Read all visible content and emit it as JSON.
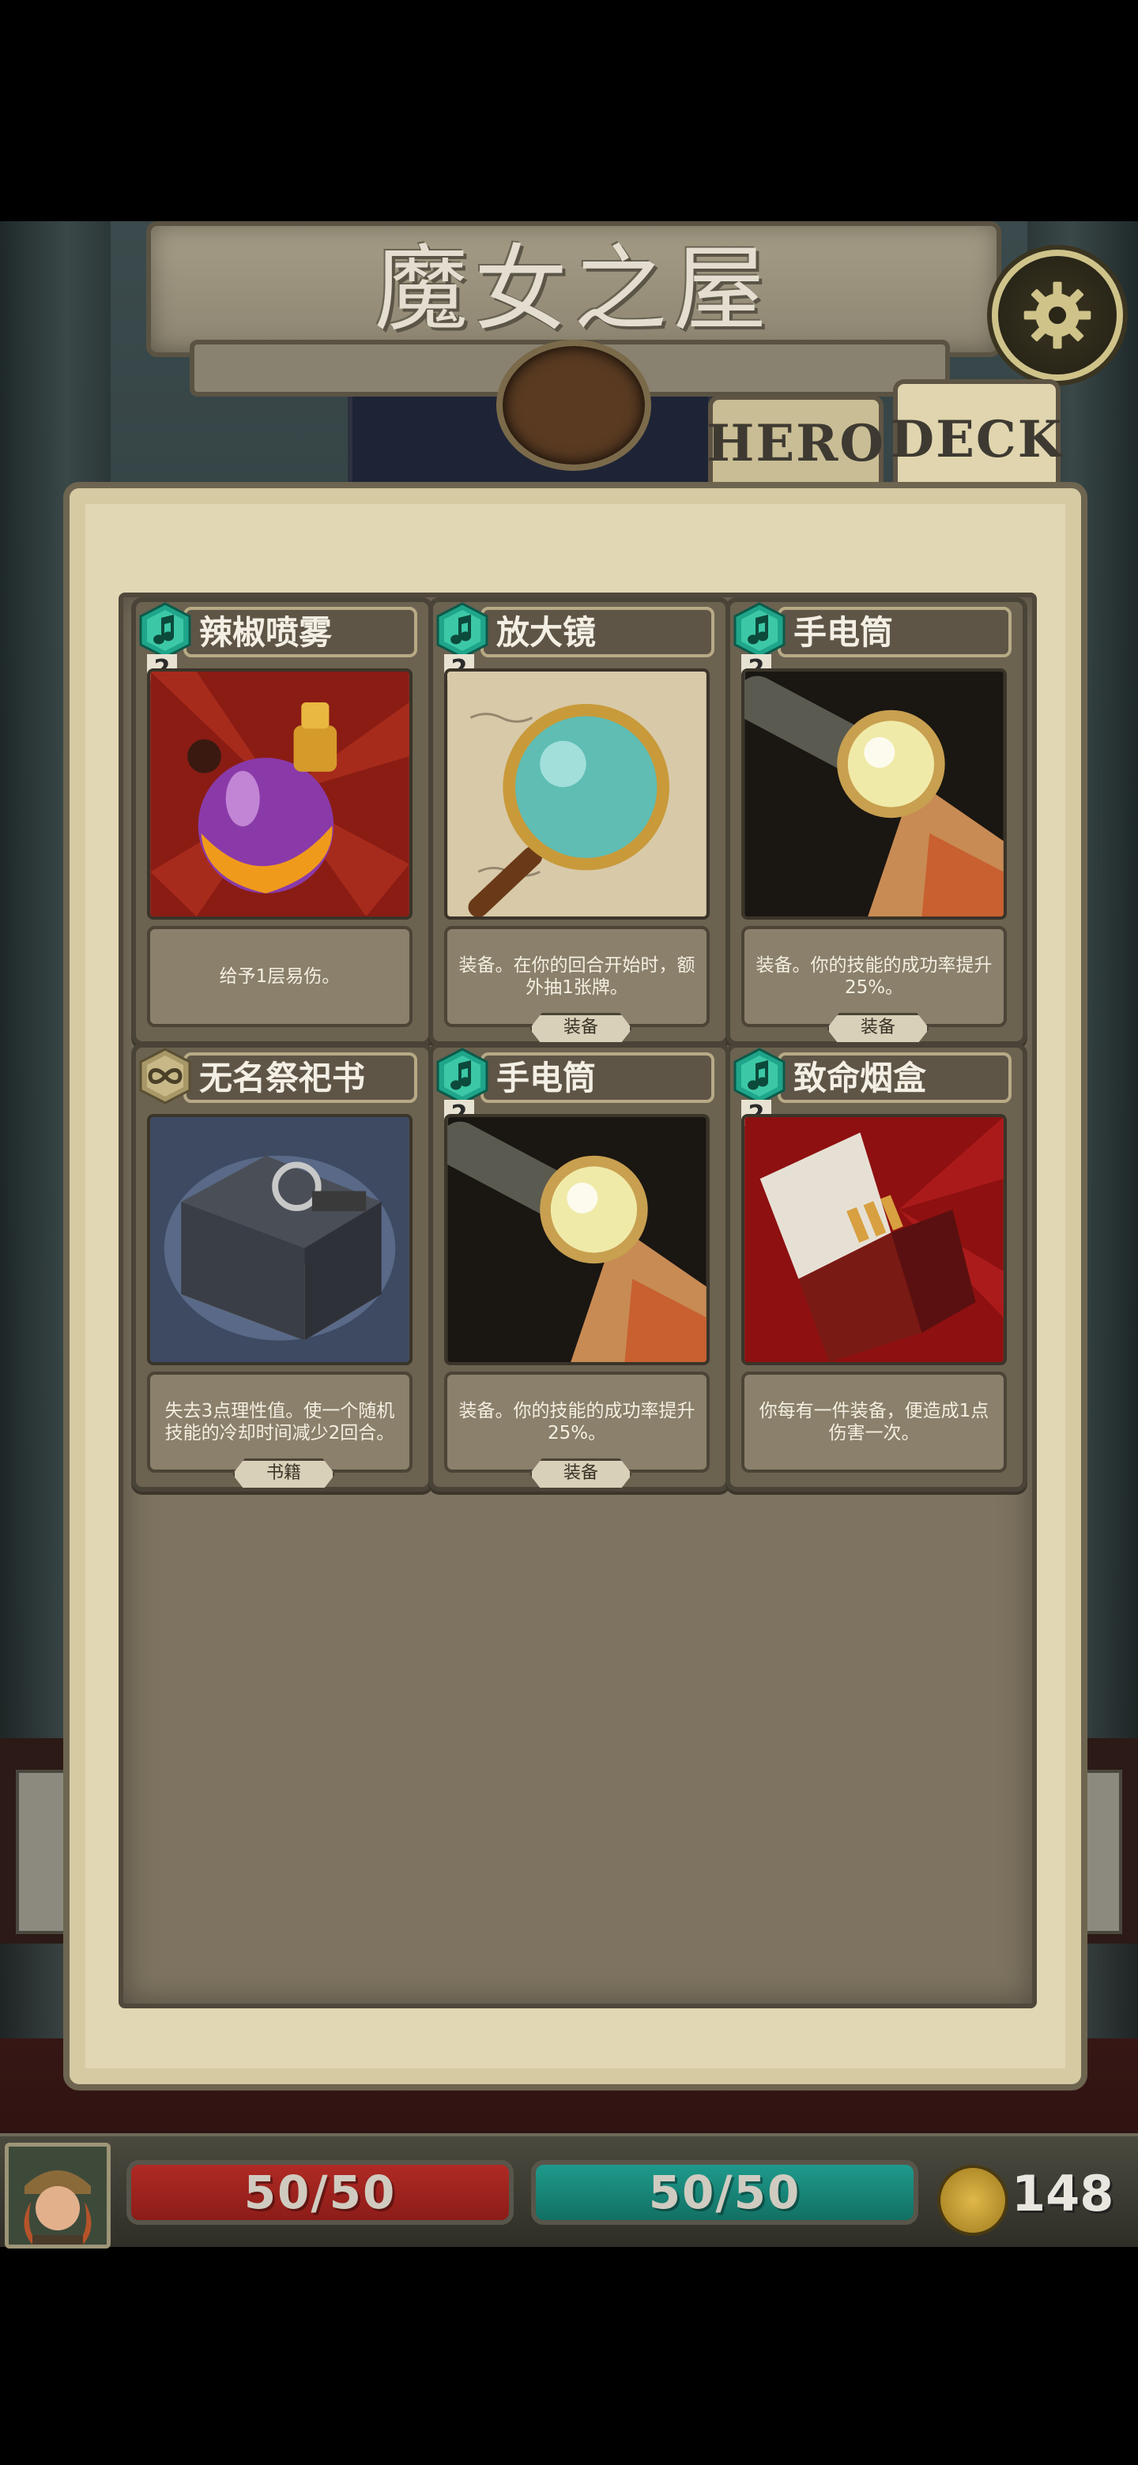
{
  "title": "魔女之屋",
  "tabs": [
    {
      "label": "HERO",
      "active": false
    },
    {
      "label": "DECK",
      "active": true
    }
  ],
  "cards": [
    {
      "name": "辣椒喷雾",
      "cost": "2",
      "type_icon": "music-note-gem-icon",
      "art_icon": "perfume-bottle-icon",
      "description": "给予1层易伤。",
      "tag": ""
    },
    {
      "name": "放大镜",
      "cost": "2",
      "type_icon": "music-note-gem-icon",
      "art_icon": "magnifying-glass-icon",
      "description": "装备。在你的回合开始时，额外抽1张牌。",
      "tag": "装备"
    },
    {
      "name": "手电筒",
      "cost": "2",
      "type_icon": "music-note-gem-icon",
      "art_icon": "flashlight-icon",
      "description": "装备。你的技能的成功率提升25%。",
      "tag": "装备"
    },
    {
      "name": "无名祭祀书",
      "cost": "",
      "type_icon": "infinity-gem-icon",
      "art_icon": "book-icon",
      "description": "失去3点理性值。使一个随机技能的冷却时间减少2回合。",
      "tag": "书籍"
    },
    {
      "name": "手电筒",
      "cost": "2",
      "type_icon": "music-note-gem-icon",
      "art_icon": "flashlight-icon",
      "description": "装备。你的技能的成功率提升25%。",
      "tag": "装备"
    },
    {
      "name": "致命烟盒",
      "cost": "2",
      "type_icon": "music-note-gem-icon",
      "art_icon": "cigarette-box-icon",
      "description": "你每有一件装备，便造成1点伤害一次。",
      "tag": ""
    }
  ],
  "hud": {
    "hp": "50/50",
    "sanity": "50/50",
    "coins": "148"
  },
  "colors": {
    "hp_bar": "#a82520",
    "sanity_bar": "#18877a",
    "panel": "#e2d7b4",
    "gem_green": "#1fa58a"
  }
}
